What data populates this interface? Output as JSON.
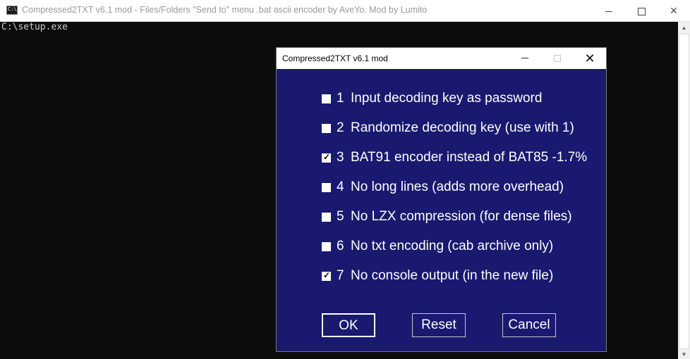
{
  "console_window": {
    "title": "Compressed2TXT v6.1 mod - Files/Folders \"Send to\" menu .bat ascii encoder by AveYo. Mod by Lumito",
    "prompt_line": "C:\\setup.exe"
  },
  "dialog": {
    "title": "Compressed2TXT v6.1 mod",
    "close_glyph": "✕",
    "options": [
      {
        "num": "1",
        "label": "Input decoding key as password",
        "checked": false
      },
      {
        "num": "2",
        "label": "Randomize decoding key (use with 1)",
        "checked": false
      },
      {
        "num": "3",
        "label": "BAT91 encoder instead of BAT85 -1.7%",
        "checked": true
      },
      {
        "num": "4",
        "label": "No long lines (adds more overhead)",
        "checked": false
      },
      {
        "num": "5",
        "label": "No LZX compression (for dense files)",
        "checked": false
      },
      {
        "num": "6",
        "label": "No txt encoding (cab archive only)",
        "checked": false
      },
      {
        "num": "7",
        "label": "No console output (in the new file)",
        "checked": true
      }
    ],
    "buttons": {
      "ok": "OK",
      "reset": "Reset",
      "cancel": "Cancel"
    },
    "background_color": "#191970"
  }
}
